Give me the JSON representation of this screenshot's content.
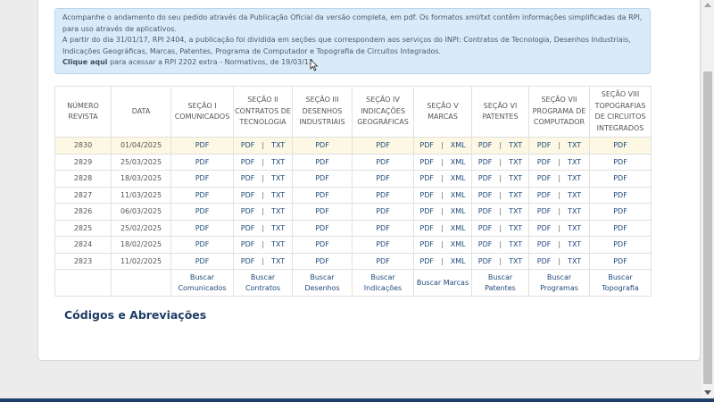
{
  "notice": {
    "line1": "Acompanhe o andamento do seu pedido através da Publicação Oficial da versão completa, em pdf. Os formatos xml/txt contêm informações simplificadas da RPI, para uso através de aplicativos.",
    "line2": "A partir do dia 31/01/17, RPI 2404, a publicação foi dividida em seções que correspondem aos serviços do INPI: Contratos de Tecnologia, Desenhos Industriais, Indicações Geográficas, Marcas, Patentes, Programa de Computador e Topografia de Circuitos Integrados.",
    "link_label": "Clique aqui",
    "link_rest": " para acessar a RPI 2202 extra - Normativos, de 19/03/13."
  },
  "table": {
    "headers": {
      "numero": [
        "NÚMERO",
        "REVISTA"
      ],
      "data": [
        "DATA"
      ],
      "s1": [
        "SEÇÃO I",
        "COMUNICADOS"
      ],
      "s2": [
        "SEÇÃO II",
        "CONTRATOS DE",
        "TECNOLOGIA"
      ],
      "s3": [
        "SEÇÃO III",
        "DESENHOS",
        "INDUSTRIAIS"
      ],
      "s4": [
        "SEÇÃO IV",
        "INDICAÇÕES",
        "GEOGRÁFICAS"
      ],
      "s5": [
        "SEÇÃO V",
        "MARCAS"
      ],
      "s6": [
        "SEÇÃO VI",
        "PATENTES"
      ],
      "s7": [
        "SEÇÃO VII",
        "PROGRAMA DE",
        "COMPUTADOR"
      ],
      "s8": [
        "SEÇÃO VIII",
        "TOPOGRAFIAS",
        "DE CIRCUITOS",
        "INTEGRADOS"
      ]
    },
    "link_pdf": "PDF",
    "link_txt": "TXT",
    "link_xml": "XML",
    "divider": "|",
    "rows": [
      {
        "numero": "2830",
        "data": "01/04/2025"
      },
      {
        "numero": "2829",
        "data": "25/03/2025"
      },
      {
        "numero": "2828",
        "data": "18/03/2025"
      },
      {
        "numero": "2827",
        "data": "11/03/2025"
      },
      {
        "numero": "2826",
        "data": "06/03/2025"
      },
      {
        "numero": "2825",
        "data": "25/02/2025"
      },
      {
        "numero": "2824",
        "data": "18/02/2025"
      },
      {
        "numero": "2823",
        "data": "11/02/2025"
      }
    ],
    "search": {
      "s1": [
        "Buscar",
        "Comunicados"
      ],
      "s2": [
        "Buscar",
        "Contratos"
      ],
      "s3": [
        "Buscar",
        "Desenhos"
      ],
      "s4": [
        "Buscar",
        "Indicações"
      ],
      "s5": [
        "Buscar Marcas"
      ],
      "s6": [
        "Buscar",
        "Patentes"
      ],
      "s7": [
        "Buscar",
        "Programas"
      ],
      "s8": [
        "Buscar",
        "Topografia"
      ]
    }
  },
  "codes_heading": "Códigos e Abreviações",
  "colors": {
    "notice_bg": "#d9ebf9",
    "highlight_row": "#fcf8e3",
    "link": "#1f4a7a",
    "footer": "#1f3f6b"
  }
}
